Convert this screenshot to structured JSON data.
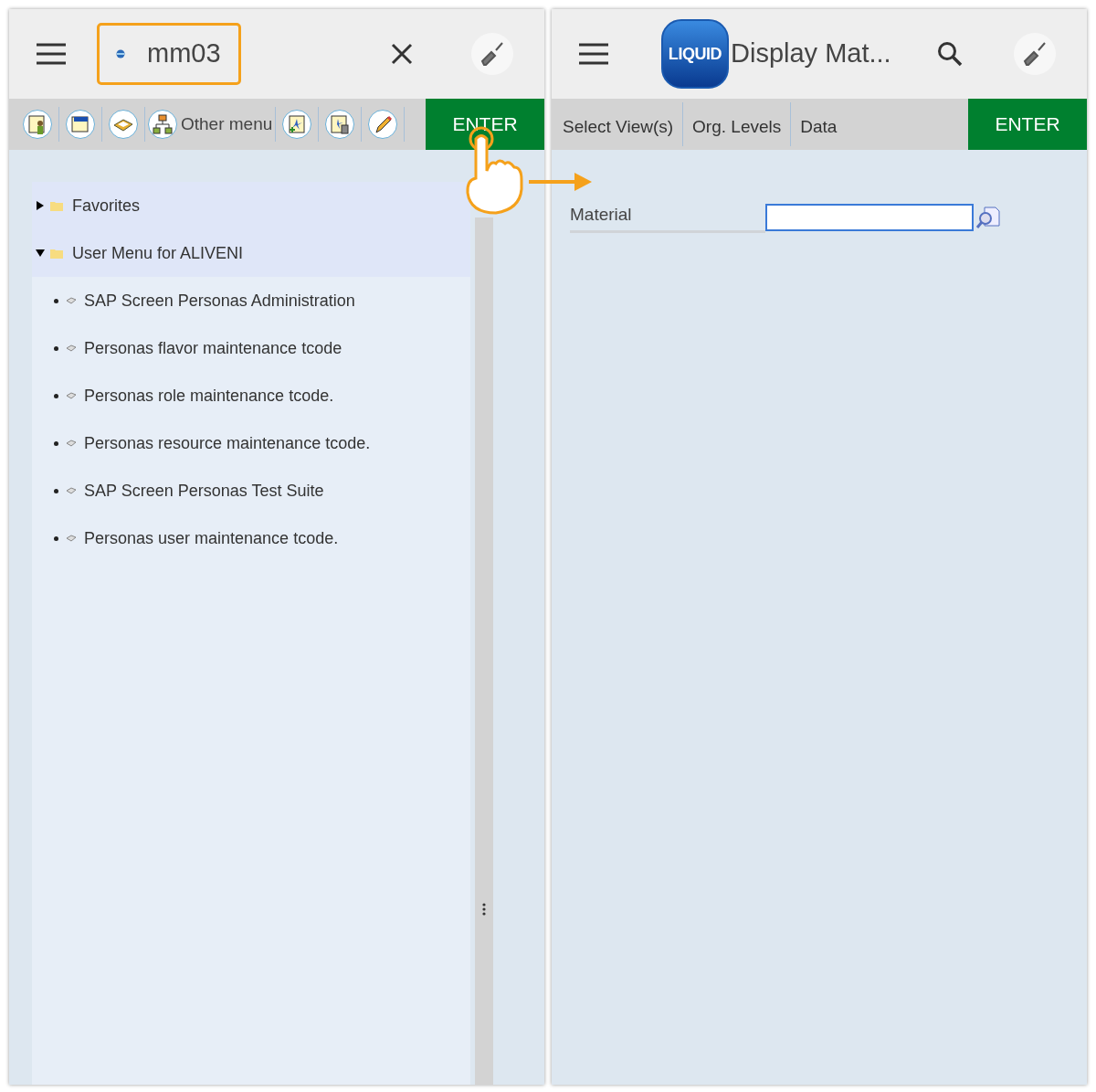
{
  "left_screen": {
    "transaction_field": {
      "value": "mm03",
      "highlighted": true
    },
    "toolbar": [
      {
        "kind": "icon"
      },
      {
        "kind": "icon"
      },
      {
        "kind": "icon"
      },
      {
        "kind": "labeled",
        "label": "Other menu"
      },
      {
        "kind": "icon"
      },
      {
        "kind": "icon"
      },
      {
        "kind": "icon"
      }
    ],
    "enter_button": "ENTER",
    "tree": [
      {
        "label": "Favorites",
        "expanded": false
      },
      {
        "label": "User Menu for ALIVENI",
        "expanded": true,
        "children": [
          {
            "label": "SAP Screen Personas Administration"
          },
          {
            "label": "Personas flavor maintenance tcode"
          },
          {
            "label": "Personas role maintenance tcode."
          },
          {
            "label": "Personas resource maintenance tcode."
          },
          {
            "label": "SAP Screen Personas Test Suite"
          },
          {
            "label": "Personas user maintenance tcode."
          }
        ]
      }
    ]
  },
  "right_screen": {
    "logo": "LIQUID",
    "title": "Display Mat...",
    "tabs": [
      "Select View(s)",
      "Org. Levels",
      "Data"
    ],
    "enter_button": "ENTER",
    "fields": [
      {
        "label": "Material"
      }
    ]
  }
}
